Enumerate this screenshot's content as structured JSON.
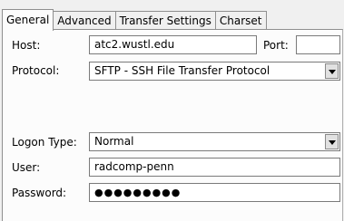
{
  "tabs": {
    "general": "General",
    "advanced": "Advanced",
    "transfer_settings": "Transfer Settings",
    "charset": "Charset",
    "active": "General"
  },
  "form": {
    "host_label": "Host:",
    "host_value": "atc2.wustl.edu",
    "port_label": "Port:",
    "port_value": "",
    "protocol_label": "Protocol:",
    "protocol_value": "SFTP - SSH File Transfer Protocol",
    "logon_type_label": "Logon Type:",
    "logon_type_value": "Normal",
    "user_label": "User:",
    "user_value": "radcomp-penn",
    "password_label": "Password:",
    "password_mask": "●●●●●●●●●"
  },
  "colors": {
    "panel_bg": "#fcfcfc",
    "window_bg": "#f0f0f0",
    "border": "#7a7a7a"
  }
}
